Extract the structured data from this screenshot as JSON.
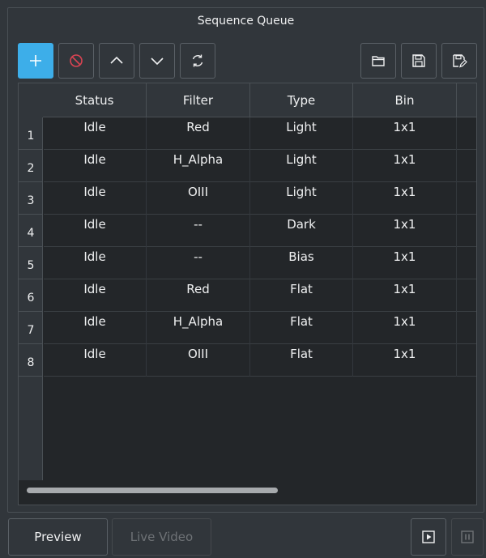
{
  "panel": {
    "title": "Sequence Queue"
  },
  "toolbar": {
    "add": "add-icon",
    "remove": "remove-icon",
    "up": "chevron-up-icon",
    "down": "chevron-down-icon",
    "reset": "reset-icon",
    "open": "folder-open-icon",
    "save": "save-icon",
    "save_as": "save-as-icon"
  },
  "table": {
    "columns": [
      "Status",
      "Filter",
      "Type",
      "Bin"
    ],
    "rows": [
      {
        "index": "1",
        "status": "Idle",
        "filter": "Red",
        "type": "Light",
        "bin": "1x1"
      },
      {
        "index": "2",
        "status": "Idle",
        "filter": "H_Alpha",
        "type": "Light",
        "bin": "1x1"
      },
      {
        "index": "3",
        "status": "Idle",
        "filter": "OIII",
        "type": "Light",
        "bin": "1x1"
      },
      {
        "index": "4",
        "status": "Idle",
        "filter": "--",
        "type": "Dark",
        "bin": "1x1"
      },
      {
        "index": "5",
        "status": "Idle",
        "filter": "--",
        "type": "Bias",
        "bin": "1x1"
      },
      {
        "index": "6",
        "status": "Idle",
        "filter": "Red",
        "type": "Flat",
        "bin": "1x1"
      },
      {
        "index": "7",
        "status": "Idle",
        "filter": "H_Alpha",
        "type": "Flat",
        "bin": "1x1"
      },
      {
        "index": "8",
        "status": "Idle",
        "filter": "OIII",
        "type": "Flat",
        "bin": "1x1"
      }
    ]
  },
  "bottom": {
    "preview_label": "Preview",
    "live_video_label": "Live Video",
    "start": "play-icon",
    "pause": "pause-icon"
  },
  "colors": {
    "accent": "#3daee9",
    "remove_red": "#da4453",
    "background": "#31363b",
    "table_bg": "#232629"
  }
}
